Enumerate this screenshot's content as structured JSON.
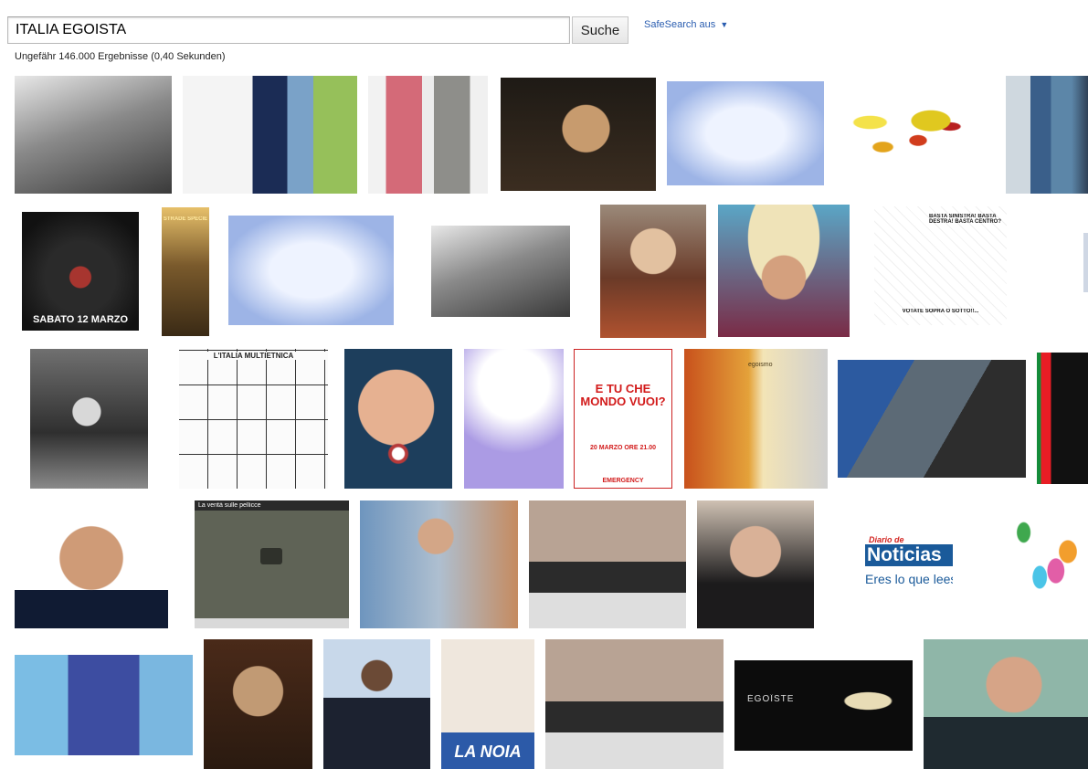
{
  "search": {
    "query": "ITALIA EGOISTA",
    "button_label": "Suche"
  },
  "safesearch": {
    "label": "SafeSearch aus",
    "arrow": "▼"
  },
  "stats": "Ungefähr 146.000 Ergebnisse (0,40 Sekunden)",
  "thumbnails": {
    "t6_text": "SABATO 12 MARZO",
    "t7_text": "STRADE SPECIE",
    "t12_text": "BASTA SINISTRA! BASTA DESTRA! BASTA CENTRO?",
    "t12_text2": "VOTATE SOPRA O SOTTO!!...",
    "t14_text": "L'ITALIA MULTIETNICA",
    "t17_title": "E TU CHE MONDO VUOI?",
    "t17_date": "20 MARZO ORE 21.00",
    "t17_footer": "EMERGENCY",
    "t18_text": "egoismo",
    "t22_text": "La verità sulle pellicce",
    "t25_text1": "Diario de",
    "t25_text2": "Noticias",
    "t25_text3": "Eres lo que lees",
    "t30_text": "LA NOIA",
    "t32_text": "ÉGOÏSTE"
  }
}
